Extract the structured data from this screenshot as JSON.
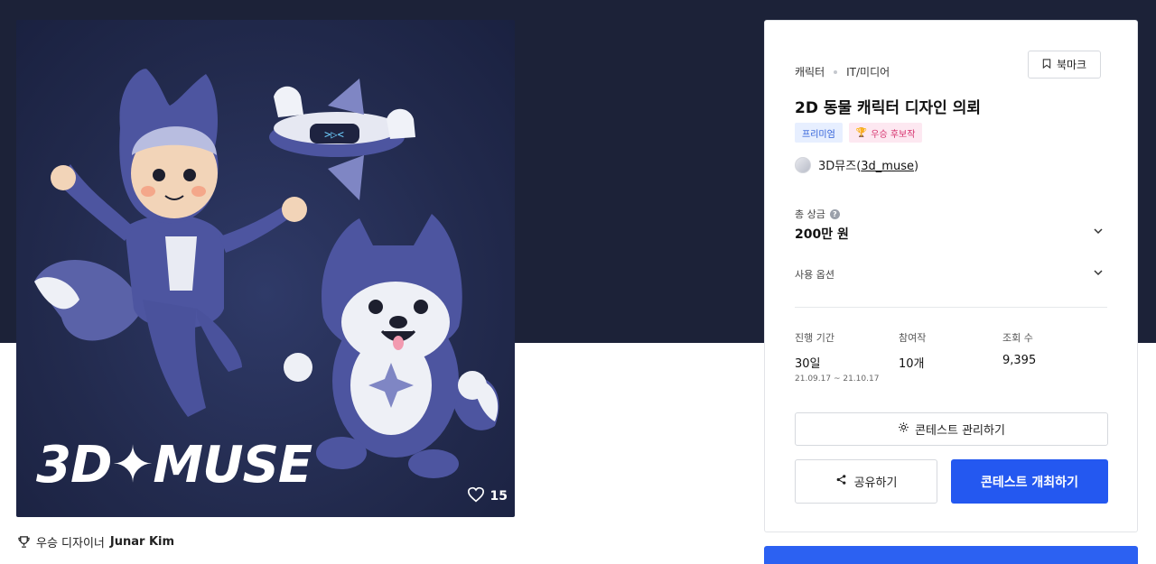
{
  "artwork": {
    "logo_text": "3D MUSE",
    "likes": "15"
  },
  "winner": {
    "label": "우승 디자이너",
    "name": "Junar Kim"
  },
  "panel": {
    "category": "캐릭터",
    "subcategory": "IT/미디어",
    "bookmark_label": "북마크",
    "title": "2D 동물 캐릭터 디자인 의뢰",
    "badge_premium": "프리미엄",
    "badge_finalist": "우승 후보작",
    "author_name": "3D뮤즈",
    "author_handle": "3d_muse",
    "prize_label": "총 상금",
    "prize_value": "200만 원",
    "usage_label": "사용 옵션",
    "stats": {
      "period_label": "진행 기간",
      "period_value": "30일",
      "period_range": "21.09.17 ~ 21.10.17",
      "entries_label": "참여작",
      "entries_value": "10개",
      "views_label": "조회 수",
      "views_value": "9,395"
    },
    "manage_label": "콘테스트 관리하기",
    "share_label": "공유하기",
    "host_label": "콘테스트 개최하기"
  },
  "colors": {
    "hero_bg": "#1c2238",
    "primary": "#2458f0",
    "premium_badge": "#e7efff",
    "finalist_badge": "#fde8f1"
  }
}
